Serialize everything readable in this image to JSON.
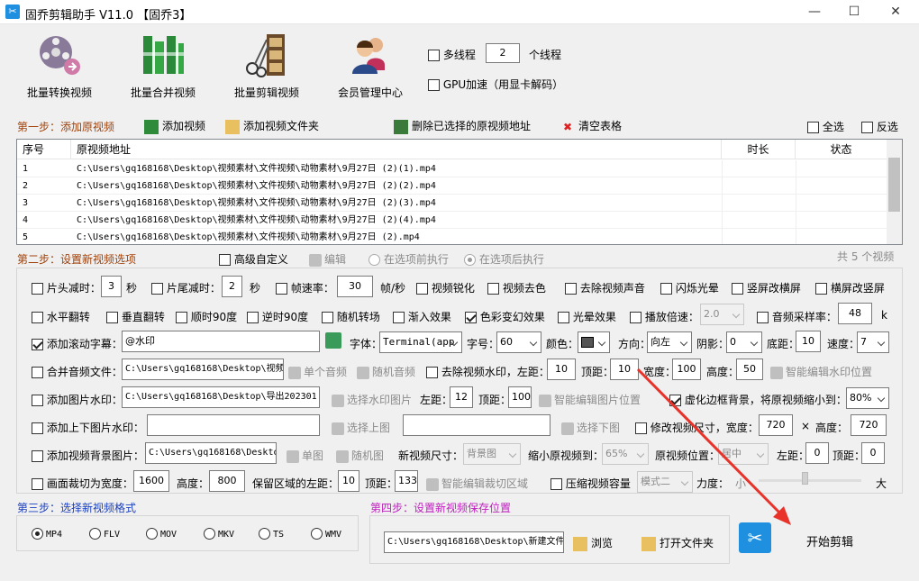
{
  "window": {
    "title": "固乔剪辑助手 V11.0  【固乔3】",
    "minimize": "—",
    "maximize": "☐",
    "close": "✕"
  },
  "toolbar": [
    {
      "label": "批量转换视频",
      "icon": "film-reel-icon"
    },
    {
      "label": "批量合并视频",
      "icon": "merge-bars-icon"
    },
    {
      "label": "批量剪辑视频",
      "icon": "scissors-film-icon"
    },
    {
      "label": "会员管理中心",
      "icon": "members-icon"
    }
  ],
  "options": {
    "multithread": "多线程",
    "thread_count": "2",
    "thread_unit": "个线程",
    "gpu": "GPU加速（用显卡解码）"
  },
  "step1": {
    "title": "第一步：添加原视频",
    "add_video": "添加视频",
    "add_folder": "添加视频文件夹",
    "delete_selected": "删除已选择的原视频地址",
    "clear_table": "清空表格",
    "select_all": "全选",
    "invert": "反选"
  },
  "table": {
    "headers": [
      "序号",
      "原视频地址",
      "时长",
      "状态"
    ],
    "rows": [
      {
        "no": "1",
        "path": "C:\\Users\\gq168168\\Desktop\\视频素材\\文件视频\\动物素材\\9月27日 (2)(1).mp4",
        "dur": "",
        "status": ""
      },
      {
        "no": "2",
        "path": "C:\\Users\\gq168168\\Desktop\\视频素材\\文件视频\\动物素材\\9月27日 (2)(2).mp4",
        "dur": "",
        "status": ""
      },
      {
        "no": "3",
        "path": "C:\\Users\\gq168168\\Desktop\\视频素材\\文件视频\\动物素材\\9月27日 (2)(3).mp4",
        "dur": "",
        "status": ""
      },
      {
        "no": "4",
        "path": "C:\\Users\\gq168168\\Desktop\\视频素材\\文件视频\\动物素材\\9月27日 (2)(4).mp4",
        "dur": "",
        "status": ""
      },
      {
        "no": "5",
        "path": "C:\\Users\\gq168168\\Desktop\\视频素材\\文件视频\\动物素材\\9月27日 (2).mp4",
        "dur": "",
        "status": ""
      }
    ]
  },
  "step2": {
    "title": "第二步：设置新视频选项",
    "advanced": "高级自定义",
    "edit": "编辑",
    "before": "在选项前执行",
    "after": "在选项后执行",
    "count": "共 5 个视频"
  },
  "row1": {
    "head_cut": "片头减时：",
    "head_val": "3",
    "sec1": "秒",
    "tail_cut": "片尾减时：",
    "tail_val": "2",
    "sec2": "秒",
    "fps": "帧速率：",
    "fps_val": "30",
    "fps_unit": "帧/秒",
    "sharpen": "视频锐化",
    "decolor": "视频去色",
    "mute": "去除视频声音",
    "flash": "闪烁光晕",
    "v2h": "竖屏改横屏",
    "h2v": "横屏改竖屏"
  },
  "row2": {
    "hflip": "水平翻转",
    "vflip": "垂直翻转",
    "rot90": "顺时90度",
    "rot_ccw": "逆时90度",
    "random": "随机转场",
    "fade": "渐入效果",
    "color": "色彩变幻效果",
    "halo": "光晕效果",
    "speed": "播放倍速：",
    "speed_val": "2.0",
    "sample": "音频采样率：",
    "sample_val": "48",
    "k": "k"
  },
  "row3": {
    "scroll": "添加滚动字幕：",
    "text": "@水印",
    "font": "字体：",
    "font_val": "Terminal(app",
    "size": "字号：",
    "size_val": "60",
    "color": "颜色：",
    "dir": "方向：",
    "dir_val": "向左",
    "shadow": "阴影：",
    "shadow_val": "0",
    "bottom": "底距：",
    "bottom_val": "10",
    "speed": "速度：",
    "speed_val": "7"
  },
  "row4": {
    "merge": "合并音频文件：",
    "path": "C:\\Users\\gq168168\\Desktop\\视频",
    "single": "单个音频",
    "rand": "随机音频",
    "remove_wm": "去除视频水印，左距：",
    "left": "10",
    "top": "顶距：",
    "top_val": "10",
    "w": "宽度：",
    "w_val": "100",
    "h": "高度：",
    "h_val": "50",
    "smart": "智能编辑水印位置"
  },
  "row5": {
    "img": "添加图片水印：",
    "path": "C:\\Users\\gq168168\\Desktop\\导出202301",
    "choose": "选择水印图片",
    "left": "左距：",
    "left_val": "12",
    "top": "顶距：",
    "top_val": "100",
    "smart": "智能编辑图片位置",
    "blur": "虚化边框背景，将原视频缩小到：",
    "blur_val": "80%"
  },
  "row6": {
    "updown": "添加上下图片水印：",
    "up": "选择上图",
    "down": "选择下图",
    "resize": "修改视频尺寸，宽度：",
    "w_val": "720",
    "x": "×",
    "h": "高度：",
    "h_val": "720"
  },
  "row7": {
    "bg": "添加视频背景图片：",
    "path": "C:\\Users\\gq168168\\Desktop",
    "single": "单图",
    "random": "随机图",
    "size": "新视频尺寸：",
    "size_val": "背景图",
    "shrink": "缩小原视频到：",
    "shrink_val": "65%",
    "pos": "原视频位置：",
    "pos_val": "居中",
    "left": "左距：",
    "left_val": "0",
    "top": "顶距：",
    "top_val": "0"
  },
  "row8": {
    "crop": "画面裁切为宽度：",
    "w_val": "1600",
    "h": "高度：",
    "h_val": "800",
    "keep": "保留区域的左距：",
    "left_val": "10",
    "top": "顶距：",
    "top_val": "133.",
    "smart": "智能编辑裁切区域",
    "compress": "压缩视频容量",
    "mode": "模式二",
    "strength": "力度：",
    "small": "小",
    "big": "大",
    "strength_level": 0.45
  },
  "step3": {
    "title": "第三步：选择新视频格式",
    "formats": [
      "MP4",
      "FLV",
      "MOV",
      "MKV",
      "TS",
      "WMV"
    ],
    "selected": "MP4"
  },
  "step4": {
    "title": "第四步：设置新视频保存位置",
    "path": "C:\\Users\\gq168168\\Desktop\\新建文件",
    "browse": "浏览",
    "open": "打开文件夹"
  },
  "start": {
    "label": "开始剪辑"
  },
  "colors": {
    "step1": "#a0420b",
    "step3": "#1a3fbf",
    "step4": "#c020c0",
    "arrow": "#e8322a",
    "accent": "#1f8fe0"
  }
}
